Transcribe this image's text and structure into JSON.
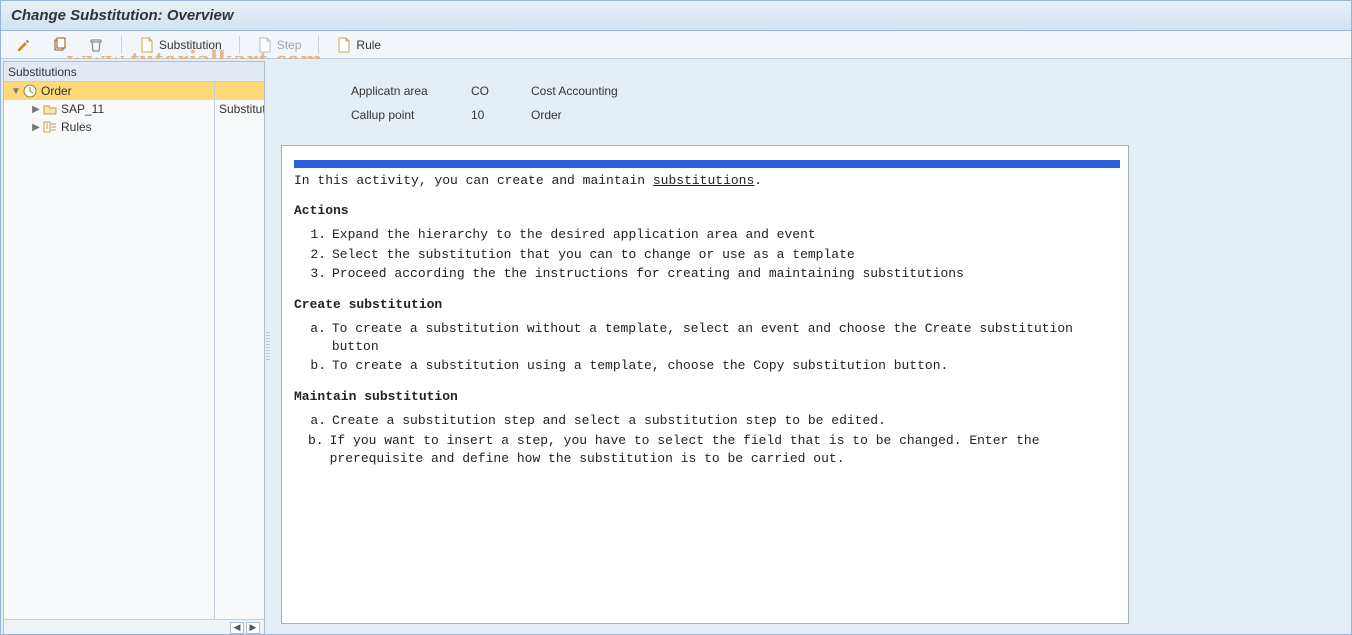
{
  "title": "Change Substitution: Overview",
  "watermark": "www.tutorialkart.com",
  "toolbar": {
    "substitution_label": "Substitution",
    "step_label": "Step",
    "rule_label": "Rule"
  },
  "tree": {
    "header": "Substitutions",
    "side_col_value": "Substitut",
    "items": [
      {
        "label": "Order",
        "icon": "clock",
        "selected": true,
        "expander": "▼"
      },
      {
        "label": "SAP_11",
        "icon": "folder",
        "selected": false,
        "child": true,
        "expander": "▶"
      },
      {
        "label": "Rules",
        "icon": "rules",
        "selected": false,
        "child": true,
        "expander": "▶"
      }
    ]
  },
  "form": {
    "applicatn_label": "Applicatn area",
    "applicatn_code": "CO",
    "applicatn_desc": "Cost Accounting",
    "callup_label": "Callup point",
    "callup_code": "10",
    "callup_desc": "Order"
  },
  "doc": {
    "intro_pre": "In this activity, you can create and maintain ",
    "intro_link": "substitutions",
    "intro_post": ".",
    "h_actions": "Actions",
    "actions": [
      "Expand the hierarchy to the desired application area and event",
      "Select the substitution that you can to change or use as a template",
      "Proceed according the the instructions for creating and maintaining substitutions"
    ],
    "h_create": "Create substitution",
    "create_items": [
      "To create a substitution without a template, select an event and choose the Create substitution button",
      "To create a substitution using a template, choose the Copy substitution button."
    ],
    "h_maintain": "Maintain substitution",
    "maintain_items": [
      "Create a substitution step and select a substitution step to be edited.",
      "If you want to insert a step, you have to select the field that is to be changed. Enter the prerequisite and define how the substitution is to be carried out."
    ]
  }
}
